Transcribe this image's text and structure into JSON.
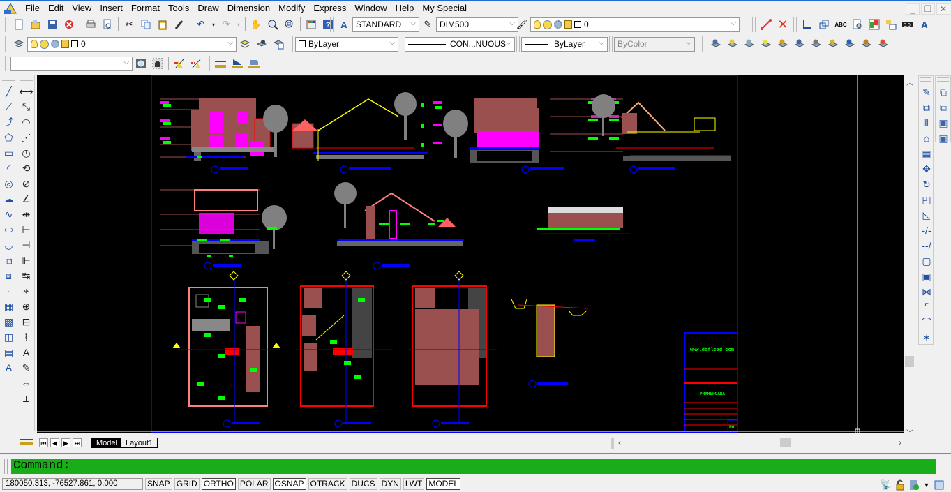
{
  "app": {
    "icon": "autocad-logo-icon"
  },
  "menu": [
    "File",
    "Edit",
    "View",
    "Insert",
    "Format",
    "Tools",
    "Draw",
    "Dimension",
    "Modify",
    "Express",
    "Window",
    "Help",
    "My Special"
  ],
  "window_controls": {
    "minimize": "_",
    "restore": "❐",
    "close": "✕"
  },
  "toolbar1": {
    "icons": [
      "new-icon",
      "open-icon",
      "save-icon",
      "close-file-icon",
      "print-icon",
      "print-preview-icon",
      "cut-icon",
      "copy-icon",
      "paste-icon",
      "match-properties-icon",
      "undo-icon",
      "redo-icon",
      "pan-icon",
      "zoom-realtime-icon",
      "zoom-window-icon",
      "toolpalettes-icon",
      "help-icon"
    ],
    "text_style": "STANDARD",
    "dim_style": "DIM500",
    "layer_combo": "0"
  },
  "toolbar_right": {
    "icons": [
      "polyline-red-icon",
      "erase-x-icon",
      "ucs-icon",
      "ucs-view-icon",
      "spell-check-icon",
      "find-icon",
      "hatch-edit-icon",
      "block-edit-icon",
      "distance-icon",
      "text-scale-icon"
    ]
  },
  "toolbar2": {
    "layer_value": "0",
    "color": "ByLayer",
    "linetype": "CON...NUOUS",
    "lineweight": "ByLayer",
    "plotstyle": "ByColor",
    "layer_tool_icons": [
      "layer-isolate-icon",
      "layer-on-icon",
      "layer-freeze-icon",
      "layer-thaw-icon",
      "layer-match-icon",
      "layer-previous-icon",
      "layer-lock-icon",
      "layer-unlock-icon",
      "zoom-extents-icon",
      "purge-icon",
      "explode-icon"
    ]
  },
  "toolbar3": {
    "combo_value": "",
    "icons": [
      "settings-icon",
      "block-icon",
      "dim-left-icon",
      "dim-right-icon",
      "dim-linear-icon",
      "dim-aligned-icon",
      "dim-3d-icon"
    ]
  },
  "draw_tools": [
    "line",
    "construction-line",
    "polyline",
    "polygon",
    "rectangle",
    "arc",
    "circle",
    "revision-cloud",
    "spline",
    "ellipse",
    "ellipse-arc",
    "insert-block",
    "make-block",
    "point",
    "hatch",
    "gradient",
    "region",
    "table",
    "multiline-text"
  ],
  "dim_tools": [
    "linear",
    "aligned",
    "arc-length",
    "ordinate",
    "radius",
    "jogged",
    "diameter",
    "angular",
    "quick-dim",
    "baseline",
    "continue",
    "dimspace",
    "dimbreak",
    "tolerance",
    "center-mark",
    "inspection",
    "jogged-linear",
    "dim-text-edit",
    "dim-edit",
    "dim-update",
    "dim-style"
  ],
  "modify_tools": [
    "erase",
    "copy",
    "mirror",
    "offset",
    "array",
    "move",
    "rotate",
    "scale",
    "stretch",
    "trim",
    "extend",
    "break-at-point",
    "break",
    "join",
    "chamfer",
    "fillet",
    "explode"
  ],
  "draworder_tools": [
    "bring-front",
    "send-back",
    "bring-above",
    "send-under"
  ],
  "tabs": {
    "model": "Model",
    "layout1": "Layout1"
  },
  "command": {
    "prompt": "Command:"
  },
  "status": {
    "coords": "180050.313, -76527.861, 0.000",
    "toggles": [
      {
        "label": "SNAP",
        "on": false
      },
      {
        "label": "GRID",
        "on": false
      },
      {
        "label": "ORTHO",
        "on": true
      },
      {
        "label": "POLAR",
        "on": false
      },
      {
        "label": "OSNAP",
        "on": true
      },
      {
        "label": "OTRACK",
        "on": false
      },
      {
        "label": "DUCS",
        "on": false
      },
      {
        "label": "DYN",
        "on": false
      },
      {
        "label": "LWT",
        "on": false
      },
      {
        "label": "MODEL",
        "on": true
      }
    ]
  },
  "drawing": {
    "title_block_url": "www.dbflcad.com",
    "title_block_project": "PRAREHCANA",
    "sheet_no": "NO",
    "colors": {
      "frame": "#0000ff",
      "wall": "#9b5050",
      "accent_magenta": "#ff00ff",
      "text_green": "#00ff00",
      "line_yellow": "#ffff00",
      "line_red": "#ff0000",
      "tree": "#808080"
    }
  }
}
